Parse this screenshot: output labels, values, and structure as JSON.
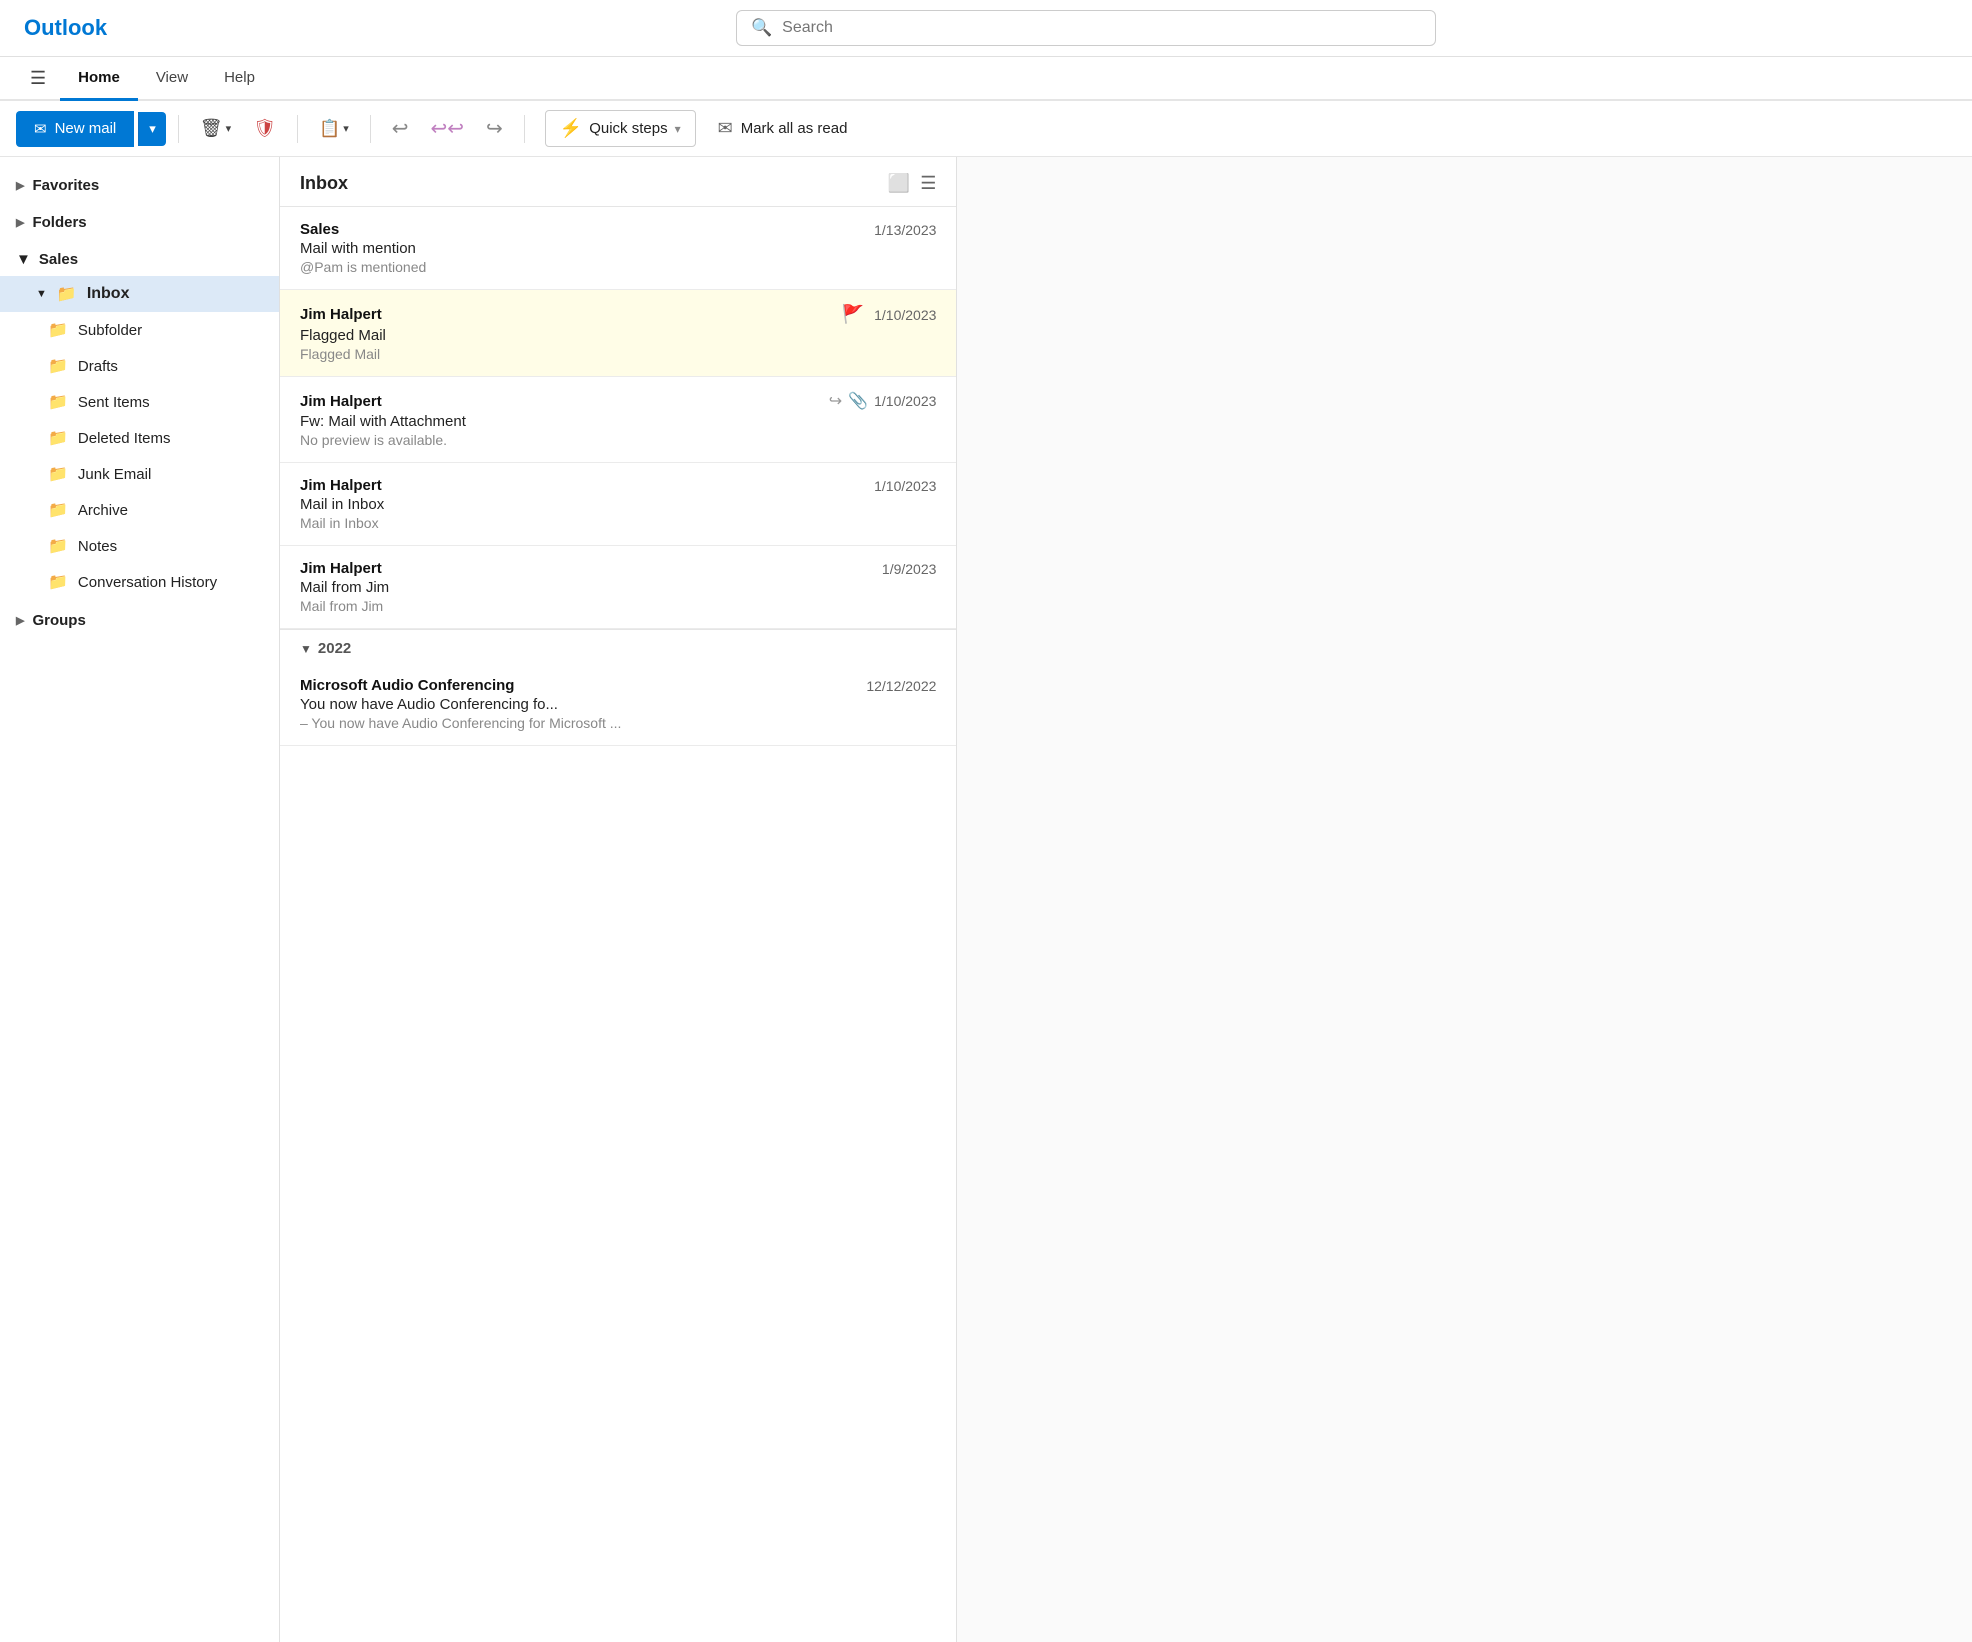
{
  "header": {
    "logo": "Outlook",
    "search_placeholder": "Search"
  },
  "nav": {
    "hamburger": "☰",
    "tabs": [
      {
        "label": "Home",
        "active": true
      },
      {
        "label": "View",
        "active": false
      },
      {
        "label": "Help",
        "active": false
      }
    ]
  },
  "toolbar": {
    "new_mail_label": "New mail",
    "dropdown_arrow": "▾",
    "delete_icon": "🗑",
    "shield_icon": "🛡",
    "move_icon": "📋",
    "reply_icon": "↩",
    "reply_all_icon": "↩↩",
    "forward_icon": "↪",
    "quick_steps_label": "Quick steps",
    "quick_steps_icon": "⚡",
    "dropdown_icon": "▾",
    "mark_read_icon": "✉",
    "mark_read_label": "Mark all as read"
  },
  "sidebar": {
    "favorites_label": "Favorites",
    "folders_label": "Folders",
    "sales_label": "Sales",
    "inbox_label": "Inbox",
    "folders_list": [
      {
        "label": "Subfolder",
        "icon": "📁"
      },
      {
        "label": "Drafts",
        "icon": "📁"
      },
      {
        "label": "Sent Items",
        "icon": "📁"
      },
      {
        "label": "Deleted Items",
        "icon": "📁"
      },
      {
        "label": "Junk Email",
        "icon": "📁"
      },
      {
        "label": "Archive",
        "icon": "📁"
      },
      {
        "label": "Notes",
        "icon": "📁"
      },
      {
        "label": "Conversation History",
        "icon": "📁"
      }
    ],
    "groups_label": "Groups"
  },
  "email_panel": {
    "title": "Inbox",
    "emails": [
      {
        "sender": "Sales",
        "subject": "Mail with mention",
        "preview": "@Pam is mentioned",
        "date": "1/13/2023",
        "flagged": false,
        "forwarded": false,
        "has_attachment": false
      },
      {
        "sender": "Jim Halpert",
        "subject": "Flagged Mail",
        "preview": "Flagged Mail",
        "date": "1/10/2023",
        "flagged": true,
        "forwarded": false,
        "has_attachment": false
      },
      {
        "sender": "Jim Halpert",
        "subject": "Fw: Mail with Attachment",
        "preview": "No preview is available.",
        "date": "1/10/2023",
        "flagged": false,
        "forwarded": true,
        "has_attachment": true
      },
      {
        "sender": "Jim Halpert",
        "subject": "Mail in Inbox",
        "preview": "Mail in Inbox",
        "date": "1/10/2023",
        "flagged": false,
        "forwarded": false,
        "has_attachment": false
      },
      {
        "sender": "Jim Halpert",
        "subject": "Mail from Jim",
        "preview": "Mail from Jim",
        "date": "1/9/2023",
        "flagged": false,
        "forwarded": false,
        "has_attachment": false
      }
    ],
    "year_section": {
      "year": "2022",
      "emails": [
        {
          "sender": "Microsoft Audio Conferencing",
          "subject": "You now have Audio Conferencing fo...",
          "preview": "– You now have Audio Conferencing for Microsoft ...",
          "date": "12/12/2022",
          "flagged": false,
          "forwarded": false,
          "has_attachment": false
        }
      ]
    }
  }
}
